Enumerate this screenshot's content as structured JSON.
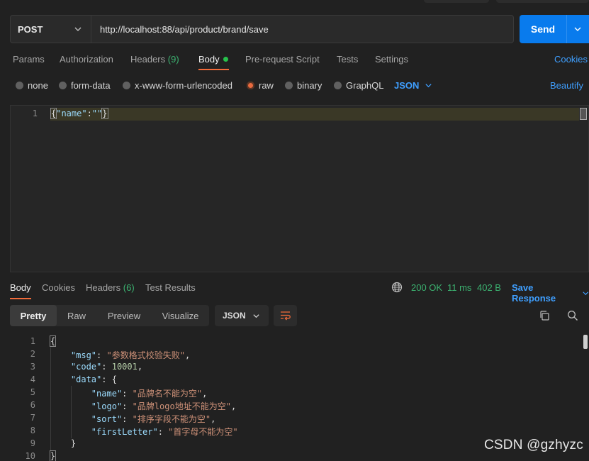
{
  "request": {
    "method": "POST",
    "url": "http://localhost:88/api/product/brand/save",
    "send_label": "Send"
  },
  "request_tabs": [
    {
      "label": "Params"
    },
    {
      "label": "Authorization"
    },
    {
      "label": "Headers",
      "count": "(9)"
    },
    {
      "label": "Body"
    },
    {
      "label": "Pre-request Script"
    },
    {
      "label": "Tests"
    },
    {
      "label": "Settings"
    }
  ],
  "cookies_link": "Cookies",
  "body_types": [
    "none",
    "form-data",
    "x-www-form-urlencoded",
    "raw",
    "binary",
    "GraphQL"
  ],
  "selected_body_type": "raw",
  "body_format": "JSON",
  "beautify_label": "Beautify",
  "request_body": {
    "line_number": "1",
    "brace_open": "{",
    "key": "\"name\"",
    "colon": ":",
    "value": "\"\"",
    "brace_close": "}"
  },
  "response_tabs": [
    {
      "label": "Body"
    },
    {
      "label": "Cookies"
    },
    {
      "label": "Headers",
      "count": "(6)"
    },
    {
      "label": "Test Results"
    }
  ],
  "response_status": {
    "status": "200 OK",
    "time": "11 ms",
    "size": "402 B",
    "save_label": "Save Response"
  },
  "view_modes": [
    "Pretty",
    "Raw",
    "Preview",
    "Visualize"
  ],
  "response_format": "JSON",
  "response_body": {
    "line_numbers": [
      "1",
      "2",
      "3",
      "4",
      "5",
      "6",
      "7",
      "8",
      "9",
      "10"
    ],
    "open": "{",
    "msg_key": "\"msg\"",
    "msg_val": "\"参数格式校验失败\"",
    "code_key": "\"code\"",
    "code_val": "10001",
    "data_key": "\"data\"",
    "data_open": "{",
    "name_key": "\"name\"",
    "name_val": "\"品牌名不能为空\"",
    "logo_key": "\"logo\"",
    "logo_val": "\"品牌logo地址不能为空\"",
    "sort_key": "\"sort\"",
    "sort_val": "\"排序字段不能为空\"",
    "first_key": "\"firstLetter\"",
    "first_val": "\"首字母不能为空\"",
    "data_close": "}",
    "close": "}"
  },
  "watermark": "CSDN @gzhyzc",
  "colors": {
    "accent": "#097bed",
    "link": "#3f9fff",
    "success": "#3cb371",
    "active_tab": "#f26b3a"
  }
}
